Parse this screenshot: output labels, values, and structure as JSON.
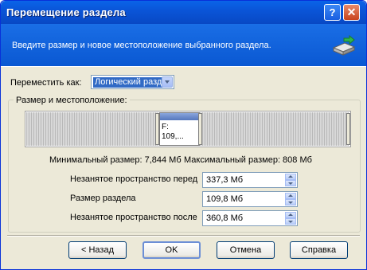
{
  "window": {
    "title": "Перемещение раздела",
    "help_glyph": "?",
    "close_glyph": "✕"
  },
  "banner": {
    "text": "Введите размер и новое местоположение выбранного раздела.",
    "icon": "partition-move-icon"
  },
  "move_as": {
    "label": "Переместить как:",
    "value": "Логический раздел"
  },
  "group": {
    "label": "Размер и местоположение:"
  },
  "partition": {
    "line1": "F:",
    "line2": "109,..."
  },
  "sizes": {
    "min": "Минимальный размер: 7,844 Мб",
    "max": "Максимальный размер: 808 Мб"
  },
  "fields": [
    {
      "label": "Незанятое пространство перед",
      "value": "337,3 Мб"
    },
    {
      "label": "Размер раздела",
      "value": "109,8 Мб"
    },
    {
      "label": "Незанятое пространство после",
      "value": "360,8 Мб"
    }
  ],
  "buttons": {
    "back": "< Назад",
    "ok": "OK",
    "cancel": "Отмена",
    "help": "Справка"
  }
}
